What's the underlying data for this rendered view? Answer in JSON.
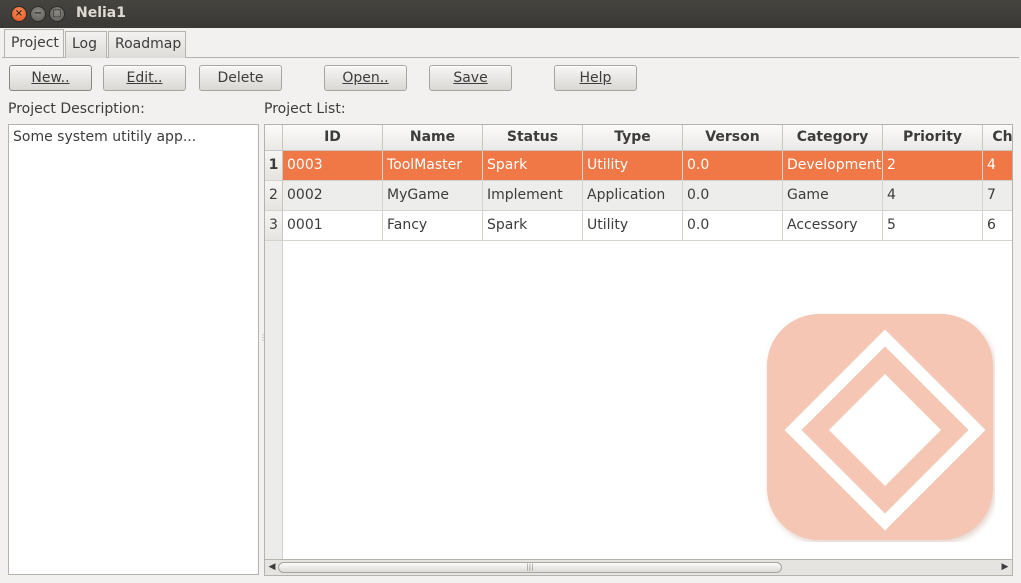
{
  "window": {
    "title": "Nelia1",
    "close_glyph": "×",
    "min_glyph": "−",
    "max_glyph": "□"
  },
  "tabs": [
    {
      "label": "Project",
      "active": true
    },
    {
      "label": "Log",
      "active": false
    },
    {
      "label": "Roadmap",
      "active": false
    }
  ],
  "toolbar": {
    "new": "New..",
    "edit": "Edit..",
    "delete": "Delete",
    "open": "Open..",
    "save": "Save",
    "help": "Help"
  },
  "description": {
    "label": "Project Description:",
    "text": "Some system utitily app..."
  },
  "project_list": {
    "label": "Project List:",
    "columns": [
      "ID",
      "Name",
      "Status",
      "Type",
      "Verson",
      "Category",
      "Priority",
      "Ch"
    ],
    "rows": [
      {
        "num": "1",
        "cells": [
          "0003",
          "ToolMaster",
          "Spark",
          "Utility",
          "0.0",
          "Development",
          "2",
          "4"
        ],
        "selected": true
      },
      {
        "num": "2",
        "cells": [
          "0002",
          "MyGame",
          "Implement",
          "Application",
          "0.0",
          "Game",
          "4",
          "7"
        ],
        "selected": false
      },
      {
        "num": "3",
        "cells": [
          "0001",
          "Fancy",
          "Spark",
          "Utility",
          "0.0",
          "Accessory",
          "5",
          "6"
        ],
        "selected": false
      }
    ]
  },
  "scrollbar": {
    "left_arrow": "◀",
    "right_arrow": "▶",
    "grip": "|||"
  },
  "colors": {
    "selection": "#f07746",
    "watermark": "#f4c6b3",
    "titlebar": "#3c3b37"
  },
  "icons": [
    "close-icon",
    "minimize-icon",
    "maximize-icon",
    "app-logo-watermark"
  ]
}
